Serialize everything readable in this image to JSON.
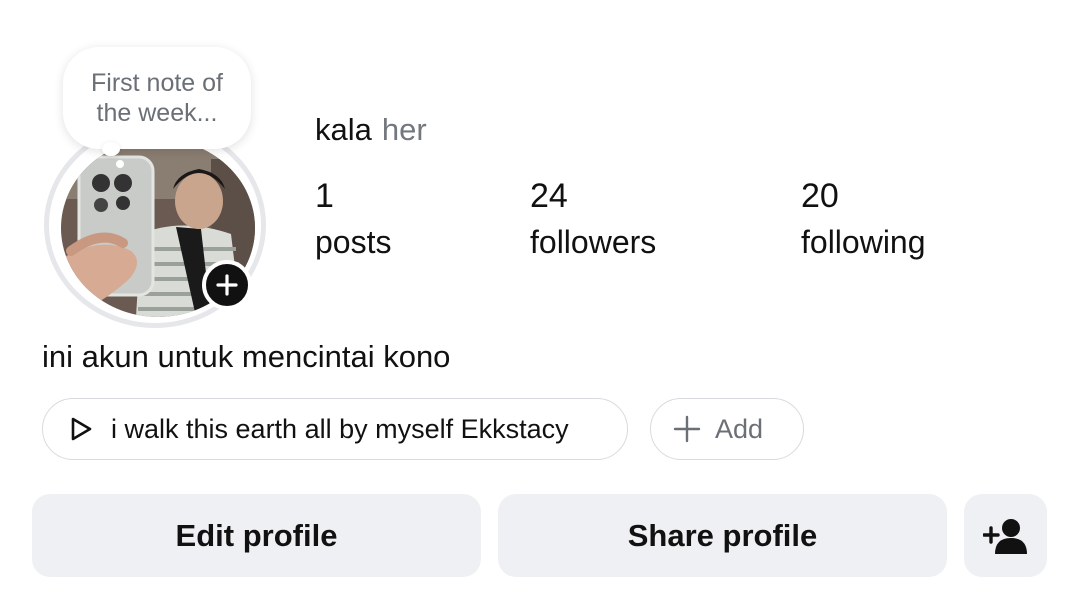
{
  "note": {
    "text": "First note of the week..."
  },
  "profile": {
    "name": "kala",
    "pronouns": "her",
    "bio": "ini akun untuk mencintai kono"
  },
  "stats": [
    {
      "value": "1",
      "label": "posts"
    },
    {
      "value": "24",
      "label": "followers"
    },
    {
      "value": "20",
      "label": "following"
    }
  ],
  "music": {
    "text": "i walk this earth all by myself Ekkstacy",
    "icon": "play-icon"
  },
  "add_link": {
    "label": "Add",
    "icon": "plus-icon"
  },
  "actions": {
    "edit_label": "Edit profile",
    "share_label": "Share profile",
    "discover_icon": "add-person-icon"
  },
  "avatar_badge_icon": "plus-icon",
  "colors": {
    "text": "#111111",
    "secondary_text": "#6b6f76",
    "button_bg": "#eff0f3",
    "border": "#d8dadf"
  }
}
